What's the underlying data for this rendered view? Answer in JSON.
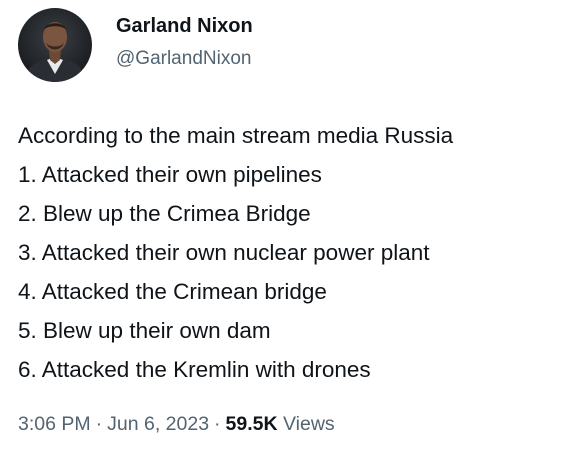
{
  "author": {
    "display_name": "Garland Nixon",
    "handle": "@GarlandNixon"
  },
  "tweet": {
    "lines": [
      "According to the main stream media Russia",
      "1. Attacked their own pipelines",
      "2. Blew up the Crimea Bridge",
      "3. Attacked their own nuclear power plant",
      "4. Attacked the Crimean bridge",
      "5. Blew up their own dam",
      "6. Attacked the Kremlin with drones"
    ]
  },
  "meta": {
    "time": "3:06 PM",
    "separator": "·",
    "date": "Jun 6, 2023",
    "views_count": "59.5K",
    "views_label": "Views"
  },
  "colors": {
    "text_primary": "#0f1419",
    "text_secondary": "#536471",
    "background": "#ffffff"
  }
}
